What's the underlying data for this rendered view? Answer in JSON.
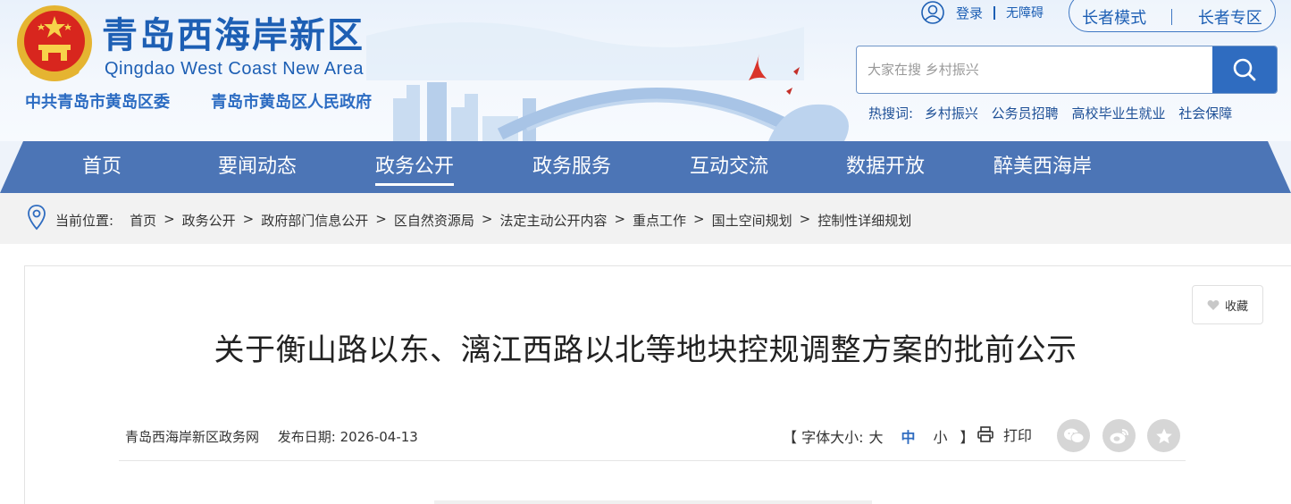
{
  "header": {
    "site_name": "青岛西海岸新区",
    "site_name_en": "Qingdao West Coast New Area",
    "org_party": "中共青岛市黄岛区委",
    "org_gov": "青岛市黄岛区人民政府",
    "login": "登录",
    "accessibility": "无障碍",
    "elder_mode": "长者模式",
    "elder_zone": "长者专区",
    "search_placeholder": "大家在搜 乡村振兴",
    "hot_label": "热搜词:",
    "hot_words": [
      "乡村振兴",
      "公务员招聘",
      "高校毕业生就业",
      "社会保障"
    ],
    "accent": "#2f6cc0"
  },
  "nav": {
    "items": [
      "首页",
      "要闻动态",
      "政务公开",
      "政务服务",
      "互动交流",
      "数据开放",
      "醉美西海岸"
    ],
    "active": "政务公开",
    "color": "#4c75b6"
  },
  "breadcrumb": {
    "label": "当前位置:",
    "items": [
      "首页",
      "政务公开",
      "政府部门信息公开",
      "区自然资源局",
      "法定主动公开内容",
      "重点工作",
      "国土空间规划",
      "控制性详细规划"
    ],
    "arrow": ">"
  },
  "article": {
    "favorite": "收藏",
    "title": "关于衡山路以东、漓江西路以北等地块控规调整方案的批前公示",
    "source": "青岛西海岸新区政务网",
    "date_label": "发布日期:",
    "date": "2026-04-13",
    "font_size_open": "【 字体大小:",
    "font_big": "大",
    "font_mid": "中",
    "font_small": "小",
    "font_size_close": "】",
    "print": "打印",
    "share_icons": [
      "wechat-icon",
      "weibo-icon",
      "star-icon"
    ]
  }
}
